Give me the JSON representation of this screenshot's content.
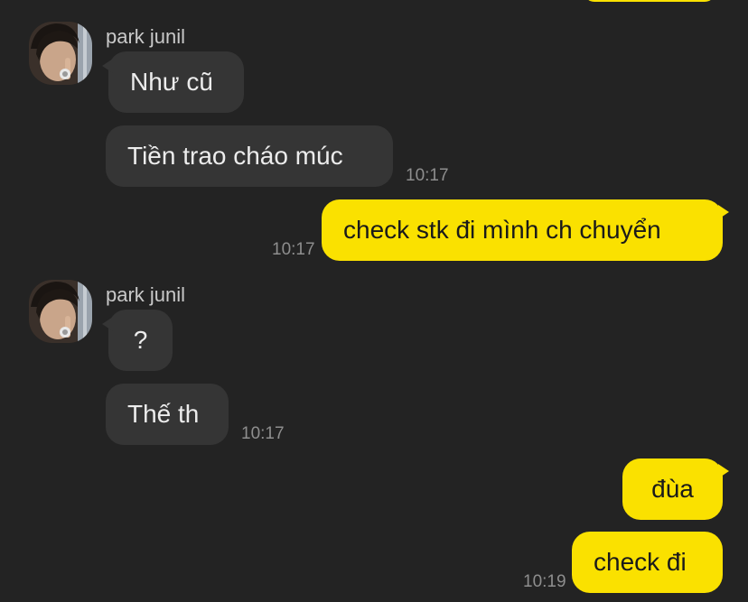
{
  "contact": {
    "name": "park junil"
  },
  "messages": {
    "m1": "Như cũ",
    "m2": "Tiền trao cháo múc",
    "m2_time": "10:17",
    "m3": "check stk đi mình ch chuyển",
    "m3_time": "10:17",
    "m4": "?",
    "m5": "Thế th",
    "m5_time": "10:17",
    "m6": "đùa",
    "m7": "check đi",
    "m7_time": "10:19"
  },
  "colors": {
    "background": "#232323",
    "incoming_bubble": "#353535",
    "outgoing_bubble": "#fae100",
    "timestamp": "#8e8e8e"
  },
  "icons": {
    "avatar": "avatar-photo"
  }
}
